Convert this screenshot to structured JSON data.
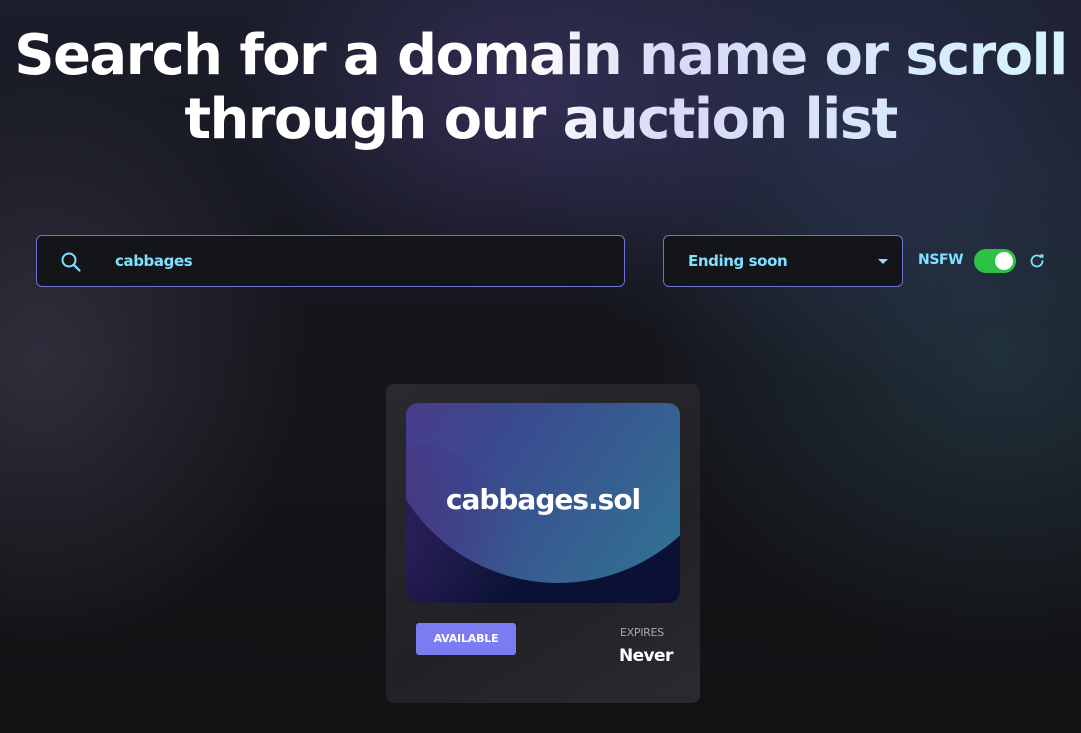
{
  "headline": {
    "line1": "Search for a domain name or scroll",
    "line2": "through our auction list"
  },
  "search": {
    "value": "cabbages",
    "icon": "search-icon"
  },
  "sort": {
    "selected": "Ending soon",
    "icon": "caret-down-icon"
  },
  "nsfw": {
    "label": "NSFW",
    "enabled": true,
    "refresh_icon": "refresh-icon"
  },
  "colors": {
    "accent": "#7fe0ff",
    "border": "#6b73d8",
    "toggle_on": "#2ec244",
    "badge": "#7b7cf2"
  },
  "results": [
    {
      "domain": "cabbages.sol",
      "status": "AVAILABLE",
      "expires_label": "EXPIRES",
      "expires_value": "Never"
    }
  ]
}
